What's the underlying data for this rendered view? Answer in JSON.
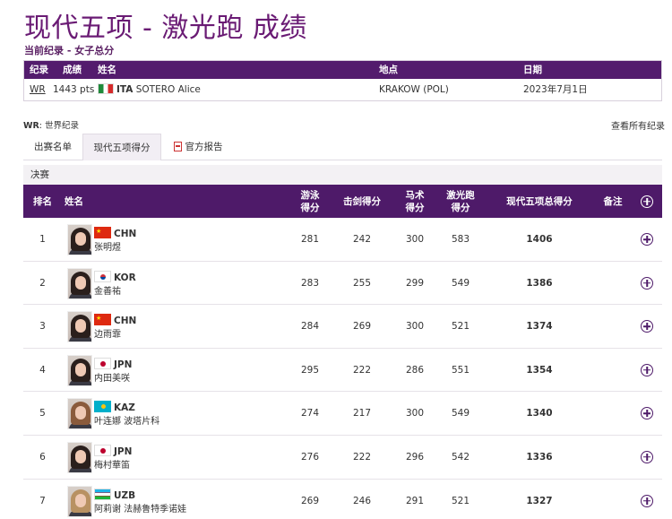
{
  "page": {
    "title": "现代五项 - 激光跑 成绩",
    "subtitle": "当前纪录 - 女子总分"
  },
  "record_table": {
    "headers": [
      "纪录",
      "成绩",
      "姓名",
      "地点",
      "日期"
    ],
    "row": {
      "record": "WR",
      "score": "1443 pts",
      "noc": "ITA",
      "name": "SOTERO Alice",
      "location": "KRAKOW (POL)",
      "date": "2023年7月1日"
    }
  },
  "legend": {
    "abbr": "WR",
    "text": ": 世界纪录"
  },
  "view_all": "查看所有纪录",
  "tabs": [
    {
      "label": "出赛名单",
      "active": false
    },
    {
      "label": "现代五项得分",
      "active": true
    },
    {
      "label": "官方报告",
      "active": false
    }
  ],
  "section_label": "决赛",
  "results": {
    "headers": {
      "rank": "排名",
      "name": "姓名",
      "swim": [
        "游泳",
        "得分"
      ],
      "fence": "击剑得分",
      "ride": [
        "马术",
        "得分"
      ],
      "laser": [
        "激光跑",
        "得分"
      ],
      "total": "现代五项总得分",
      "note": "备注"
    },
    "rows": [
      {
        "rank": "1",
        "noc": "CHN",
        "flag": "chn",
        "name": "张明煜",
        "swim": "281",
        "fence": "242",
        "ride": "300",
        "laser": "583",
        "total": "1406",
        "hair": "dark"
      },
      {
        "rank": "2",
        "noc": "KOR",
        "flag": "kor",
        "name": "金善祐",
        "swim": "283",
        "fence": "255",
        "ride": "299",
        "laser": "549",
        "total": "1386",
        "hair": "dark"
      },
      {
        "rank": "3",
        "noc": "CHN",
        "flag": "chn",
        "name": "边雨霏",
        "swim": "284",
        "fence": "269",
        "ride": "300",
        "laser": "521",
        "total": "1374",
        "hair": "dark"
      },
      {
        "rank": "4",
        "noc": "JPN",
        "flag": "jpn",
        "name": "内田美咲",
        "swim": "295",
        "fence": "222",
        "ride": "286",
        "laser": "551",
        "total": "1354",
        "hair": "dark"
      },
      {
        "rank": "5",
        "noc": "KAZ",
        "flag": "kaz",
        "name": "叶连娜 波塔片科",
        "swim": "274",
        "fence": "217",
        "ride": "300",
        "laser": "549",
        "total": "1340",
        "hair": "light"
      },
      {
        "rank": "6",
        "noc": "JPN",
        "flag": "jpn",
        "name": "梅村華笛",
        "swim": "276",
        "fence": "222",
        "ride": "296",
        "laser": "542",
        "total": "1336",
        "hair": "dark"
      },
      {
        "rank": "7",
        "noc": "UZB",
        "flag": "uzb",
        "name": "阿莉谢 法赫鲁特季诺娃",
        "swim": "269",
        "fence": "246",
        "ride": "291",
        "laser": "521",
        "total": "1327",
        "hair": "blond"
      }
    ]
  },
  "colors": {
    "brand_purple": "#531c6d",
    "title_purple": "#6a1b74"
  }
}
